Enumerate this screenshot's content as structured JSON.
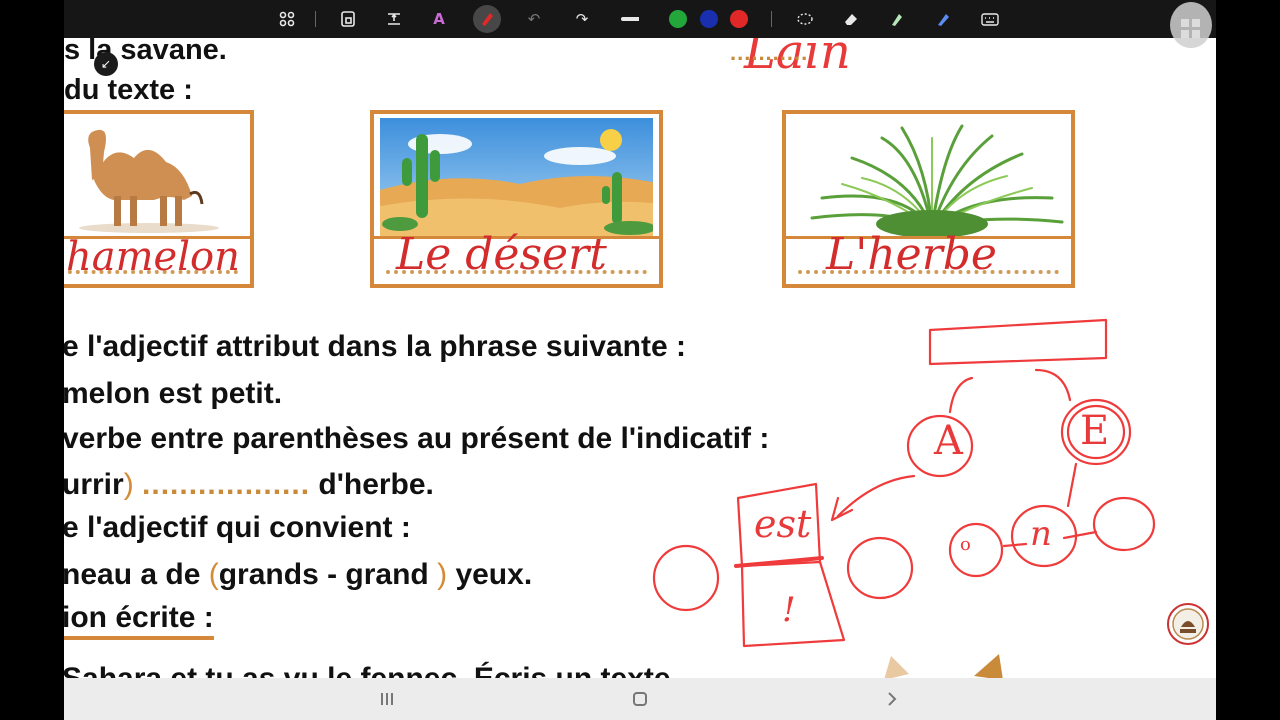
{
  "toolbar": {
    "icons": [
      "apps-icon",
      "lock-icon",
      "text-tool-icon",
      "lasso-text-icon",
      "pen-icon",
      "undo-icon",
      "redo-icon",
      "stroke-width-icon",
      "lasso-select-icon",
      "eraser-icon",
      "highlighter-icon",
      "pencil-icon",
      "keyboard-icon"
    ],
    "colors": {
      "green": "#23a73a",
      "blue": "#1a2fb0",
      "red": "#e12828"
    }
  },
  "worksheet": {
    "line_savane": "s la savane.",
    "line_texte": "du texte :",
    "handwriting_top": "Lain",
    "top_dots": "...........",
    "cards": [
      {
        "word": "hamelon",
        "name": "camel"
      },
      {
        "word": "Le désert",
        "name": "desert"
      },
      {
        "word": "L'herbe",
        "name": "grass"
      }
    ],
    "q1": "e l'adjectif attribut dans la phrase suivante :",
    "q1_sentence": "melon est petit.",
    "q2": "verbe entre parenthèses au présent de l'indicatif :",
    "q2_part1": "urrir",
    "q2_paren": ")",
    "q2_dots": "..................",
    "q2_part2": "d'herbe.",
    "q3": "e l'adjectif qui convient :",
    "q3_part1": "neau a de",
    "q3_open": "(",
    "q3_choice": "grands - grand",
    "q3_close": ")",
    "q3_part2": "yeux.",
    "section": "ion écrite :",
    "bottom_line": "Sahara et tu as vu le fennec. Écris un texte"
  },
  "annotations": {
    "a": "A",
    "e": "E",
    "est": "est",
    "excl": "!",
    "o_small": "o",
    "n": "n"
  }
}
